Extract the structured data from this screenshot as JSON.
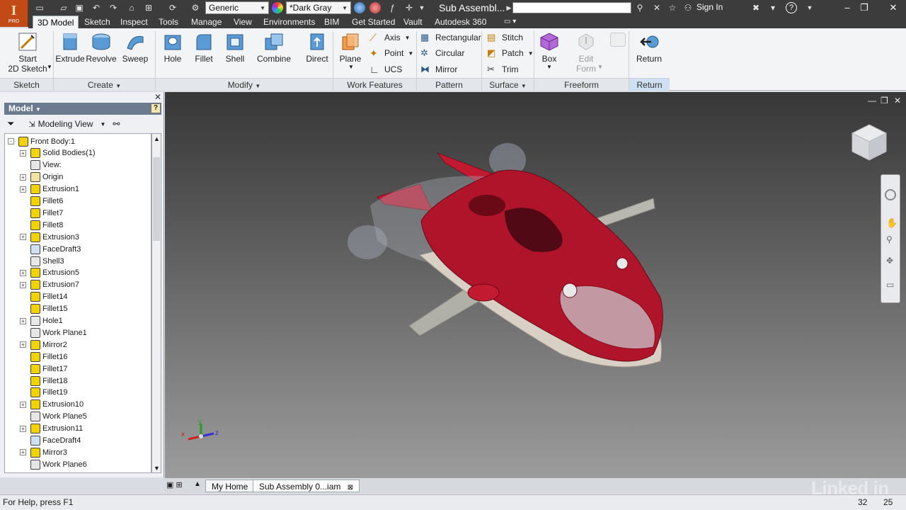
{
  "app": {
    "logo_letter": "I",
    "edition": "PRO",
    "document_title": "Sub Assembl...",
    "material_select": "Generic",
    "appearance_select": "*Dark Gray",
    "sign_in": "Sign In",
    "help": "?"
  },
  "ribbon_tabs": [
    "3D Model",
    "Sketch",
    "Inspect",
    "Tools",
    "Manage",
    "View",
    "Environments",
    "BIM",
    "Get Started",
    "Vault",
    "Autodesk 360"
  ],
  "ribbon": {
    "start_sketch": "Start\n2D Sketch",
    "start_sketch_line1": "Start",
    "start_sketch_line2": "2D Sketch",
    "create_buttons": [
      "Extrude",
      "Revolve",
      "Sweep"
    ],
    "modify_buttons": [
      "Hole",
      "Fillet",
      "Shell",
      "Combine",
      "Direct"
    ],
    "work_plane": "Plane",
    "work_small": [
      "Axis",
      "Point",
      "UCS"
    ],
    "pattern_small": [
      "Rectangular",
      "Circular",
      "Mirror"
    ],
    "surface_small": [
      "Stitch",
      "Patch",
      "Trim"
    ],
    "box": "Box",
    "edit_form_line1": "Edit",
    "edit_form_line2": "Form",
    "return": "Return",
    "panels": [
      "Sketch",
      "Create",
      "Modify",
      "Work Features",
      "Pattern",
      "Surface",
      "Freeform",
      "Return"
    ]
  },
  "browser": {
    "header": "Model",
    "help": "?",
    "view_label": "Modeling View",
    "items": [
      {
        "label": "Front Body:1",
        "exp": "-",
        "indent": 0
      },
      {
        "label": "Solid Bodies(1)",
        "exp": "+",
        "indent": 1
      },
      {
        "label": "View:",
        "exp": "",
        "indent": 1
      },
      {
        "label": "Origin",
        "exp": "+",
        "indent": 1
      },
      {
        "label": "Extrusion1",
        "exp": "+",
        "indent": 1
      },
      {
        "label": "Fillet6",
        "exp": "",
        "indent": 1
      },
      {
        "label": "Fillet7",
        "exp": "",
        "indent": 1
      },
      {
        "label": "Fillet8",
        "exp": "",
        "indent": 1
      },
      {
        "label": "Extrusion3",
        "exp": "+",
        "indent": 1
      },
      {
        "label": "FaceDraft3",
        "exp": "",
        "indent": 1
      },
      {
        "label": "Shell3",
        "exp": "",
        "indent": 1
      },
      {
        "label": "Extrusion5",
        "exp": "+",
        "indent": 1
      },
      {
        "label": "Extrusion7",
        "exp": "+",
        "indent": 1
      },
      {
        "label": "Fillet14",
        "exp": "",
        "indent": 1
      },
      {
        "label": "Fillet15",
        "exp": "",
        "indent": 1
      },
      {
        "label": "Hole1",
        "exp": "+",
        "indent": 1
      },
      {
        "label": "Work Plane1",
        "exp": "",
        "indent": 1
      },
      {
        "label": "Mirror2",
        "exp": "+",
        "indent": 1
      },
      {
        "label": "Fillet16",
        "exp": "",
        "indent": 1
      },
      {
        "label": "Fillet17",
        "exp": "",
        "indent": 1
      },
      {
        "label": "Fillet18",
        "exp": "",
        "indent": 1
      },
      {
        "label": "Fillet19",
        "exp": "",
        "indent": 1
      },
      {
        "label": "Extrusion10",
        "exp": "+",
        "indent": 1
      },
      {
        "label": "Work Plane5",
        "exp": "",
        "indent": 1
      },
      {
        "label": "Extrusion11",
        "exp": "+",
        "indent": 1
      },
      {
        "label": "FaceDraft4",
        "exp": "",
        "indent": 1
      },
      {
        "label": "Mirror3",
        "exp": "+",
        "indent": 1
      },
      {
        "label": "Work Plane6",
        "exp": "",
        "indent": 1
      }
    ]
  },
  "viewport": {
    "axis_labels": [
      "x",
      "y",
      "z"
    ],
    "model_color": "#b0142a",
    "background_top": "#373737",
    "background_bottom": "#9c9c9c"
  },
  "doc_tabs": [
    "My Home",
    "Sub Assembly 0...iam"
  ],
  "status": {
    "help_text": "For Help, press F1",
    "count1": "32",
    "count2": "25"
  },
  "watermark": "Linked in"
}
